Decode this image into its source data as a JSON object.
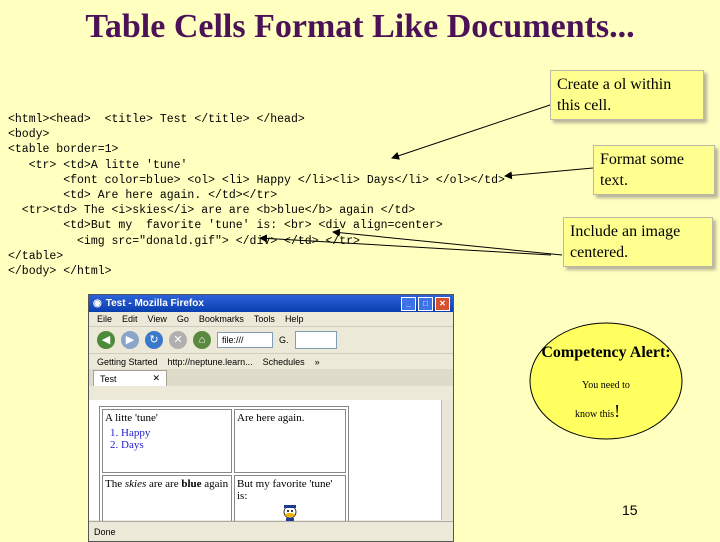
{
  "slide": {
    "title": "Table Cells Format Like Documents...",
    "code_lines": [
      "<html><head>  <title> Test </title> </head>",
      "<body>",
      "<table border=1>",
      "   <tr> <td>A litte 'tune'",
      "        <font color=blue> <ol> <li> Happy </li><li> Days</li> </ol></td>",
      "        <td> Are here again. </td></tr>",
      "  <tr><td> The <i>skies</i> are are <b>blue</b> again </td>",
      "        <td>But my  favorite 'tune' is: <br> <div align=center>",
      "          <img src=\"donald.gif\"> </div> </td> </tr>",
      "</table>",
      "</body> </html>"
    ],
    "callouts": {
      "ol": "Create a ol within this cell.",
      "format": "Format some text.",
      "image": "Include an image centered."
    },
    "alert": {
      "title": "Competency Alert:",
      "line1": "You need to",
      "line2": "know this",
      "bang": "!"
    },
    "page_number": "15"
  },
  "browser": {
    "window_title": "Test - Mozilla Firefox",
    "menu": [
      "Eile",
      "Edit",
      "View",
      "Go",
      "Bookmarks",
      "Tools",
      "Help"
    ],
    "url_text": "file:///",
    "search_text": "G.",
    "bookmarks": [
      "Getting Started",
      "http://neptune.learn...",
      "Schedules"
    ],
    "bookmarks_more": "»",
    "tab_label": "Test",
    "status": "Done",
    "table": {
      "r1c1_text": "A litte 'tune'",
      "r1c1_list": [
        "Happy",
        "Days"
      ],
      "r1c2": "Are here again.",
      "r2c1_pre": "The",
      "r2c1_italic": "skies",
      "r2c1_mid": "are are",
      "r2c1_bold": "blue",
      "r2c1_post": "again",
      "r2c2": "But my favorite 'tune' is:"
    }
  },
  "colors": {
    "background": "#ffffc0",
    "title": "#4b1258",
    "callout_fill": "#ffff90",
    "alert_fill": "#ffff60",
    "list_blue": "#1b1bcc"
  }
}
